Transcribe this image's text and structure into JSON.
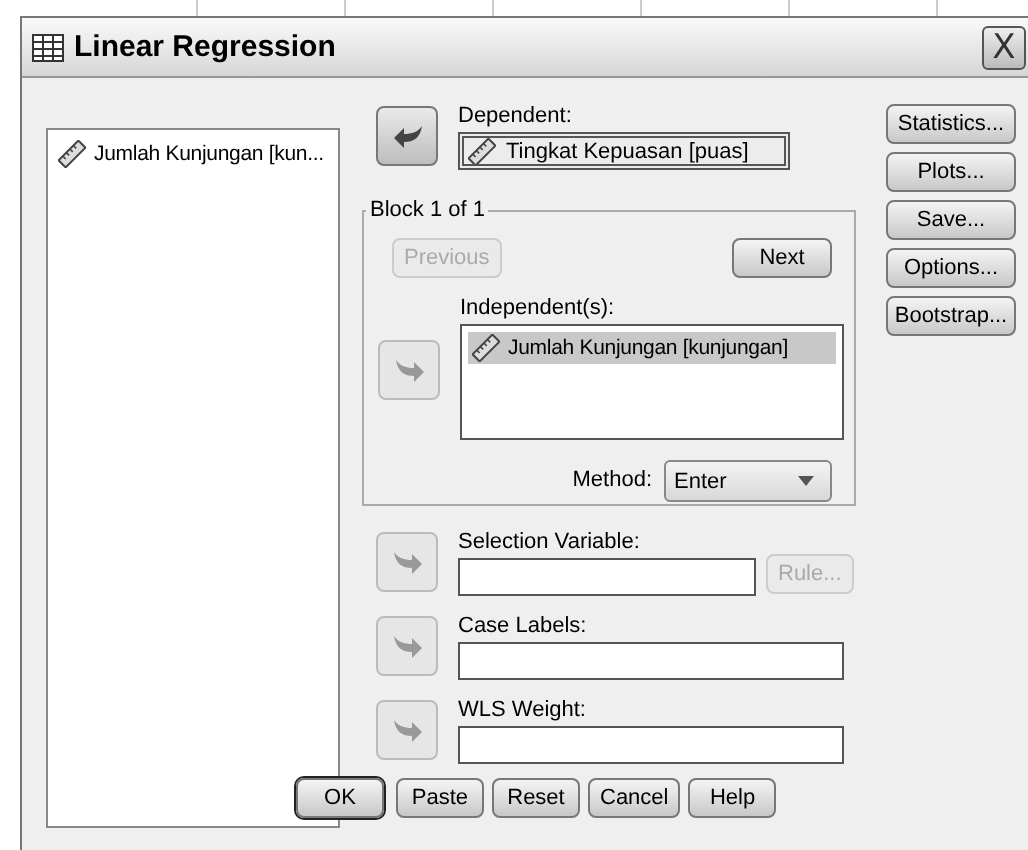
{
  "window": {
    "title": "Linear Regression",
    "close": "X"
  },
  "variables": [
    {
      "label": "Jumlah Kunjungan [kun...",
      "kind": "scale"
    }
  ],
  "dependent": {
    "label": "Dependent:",
    "value": "Tingkat Kepuasan [puas]",
    "kind": "scale"
  },
  "block": {
    "title": "Block 1 of 1",
    "previous": {
      "label": "Previous",
      "disabled": true
    },
    "next": {
      "label": "Next",
      "disabled": false
    },
    "independents_label": {
      "label": "Independent(s):"
    },
    "independents": [
      {
        "label": "Jumlah Kunjungan [kunjungan]",
        "kind": "scale",
        "selected": true
      }
    ],
    "method": {
      "label": "Method:",
      "value": "Enter"
    }
  },
  "selection_variable": {
    "label": "Selection Variable:",
    "rule": {
      "label": "Rule...",
      "disabled": true
    }
  },
  "case_labels": {
    "label": "Case Labels:"
  },
  "wls_weight": {
    "label": "WLS Weight:"
  },
  "side_buttons": [
    {
      "label": "Statistics..."
    },
    {
      "label": "Plots..."
    },
    {
      "label": "Save..."
    },
    {
      "label": "Options..."
    },
    {
      "label": "Bootstrap..."
    }
  ],
  "bottom_buttons": [
    {
      "label": "OK",
      "default": true
    },
    {
      "label": "Paste",
      "default": false
    },
    {
      "label": "Reset",
      "default": false
    },
    {
      "label": "Cancel",
      "default": false
    },
    {
      "label": "Help",
      "default": false
    }
  ]
}
